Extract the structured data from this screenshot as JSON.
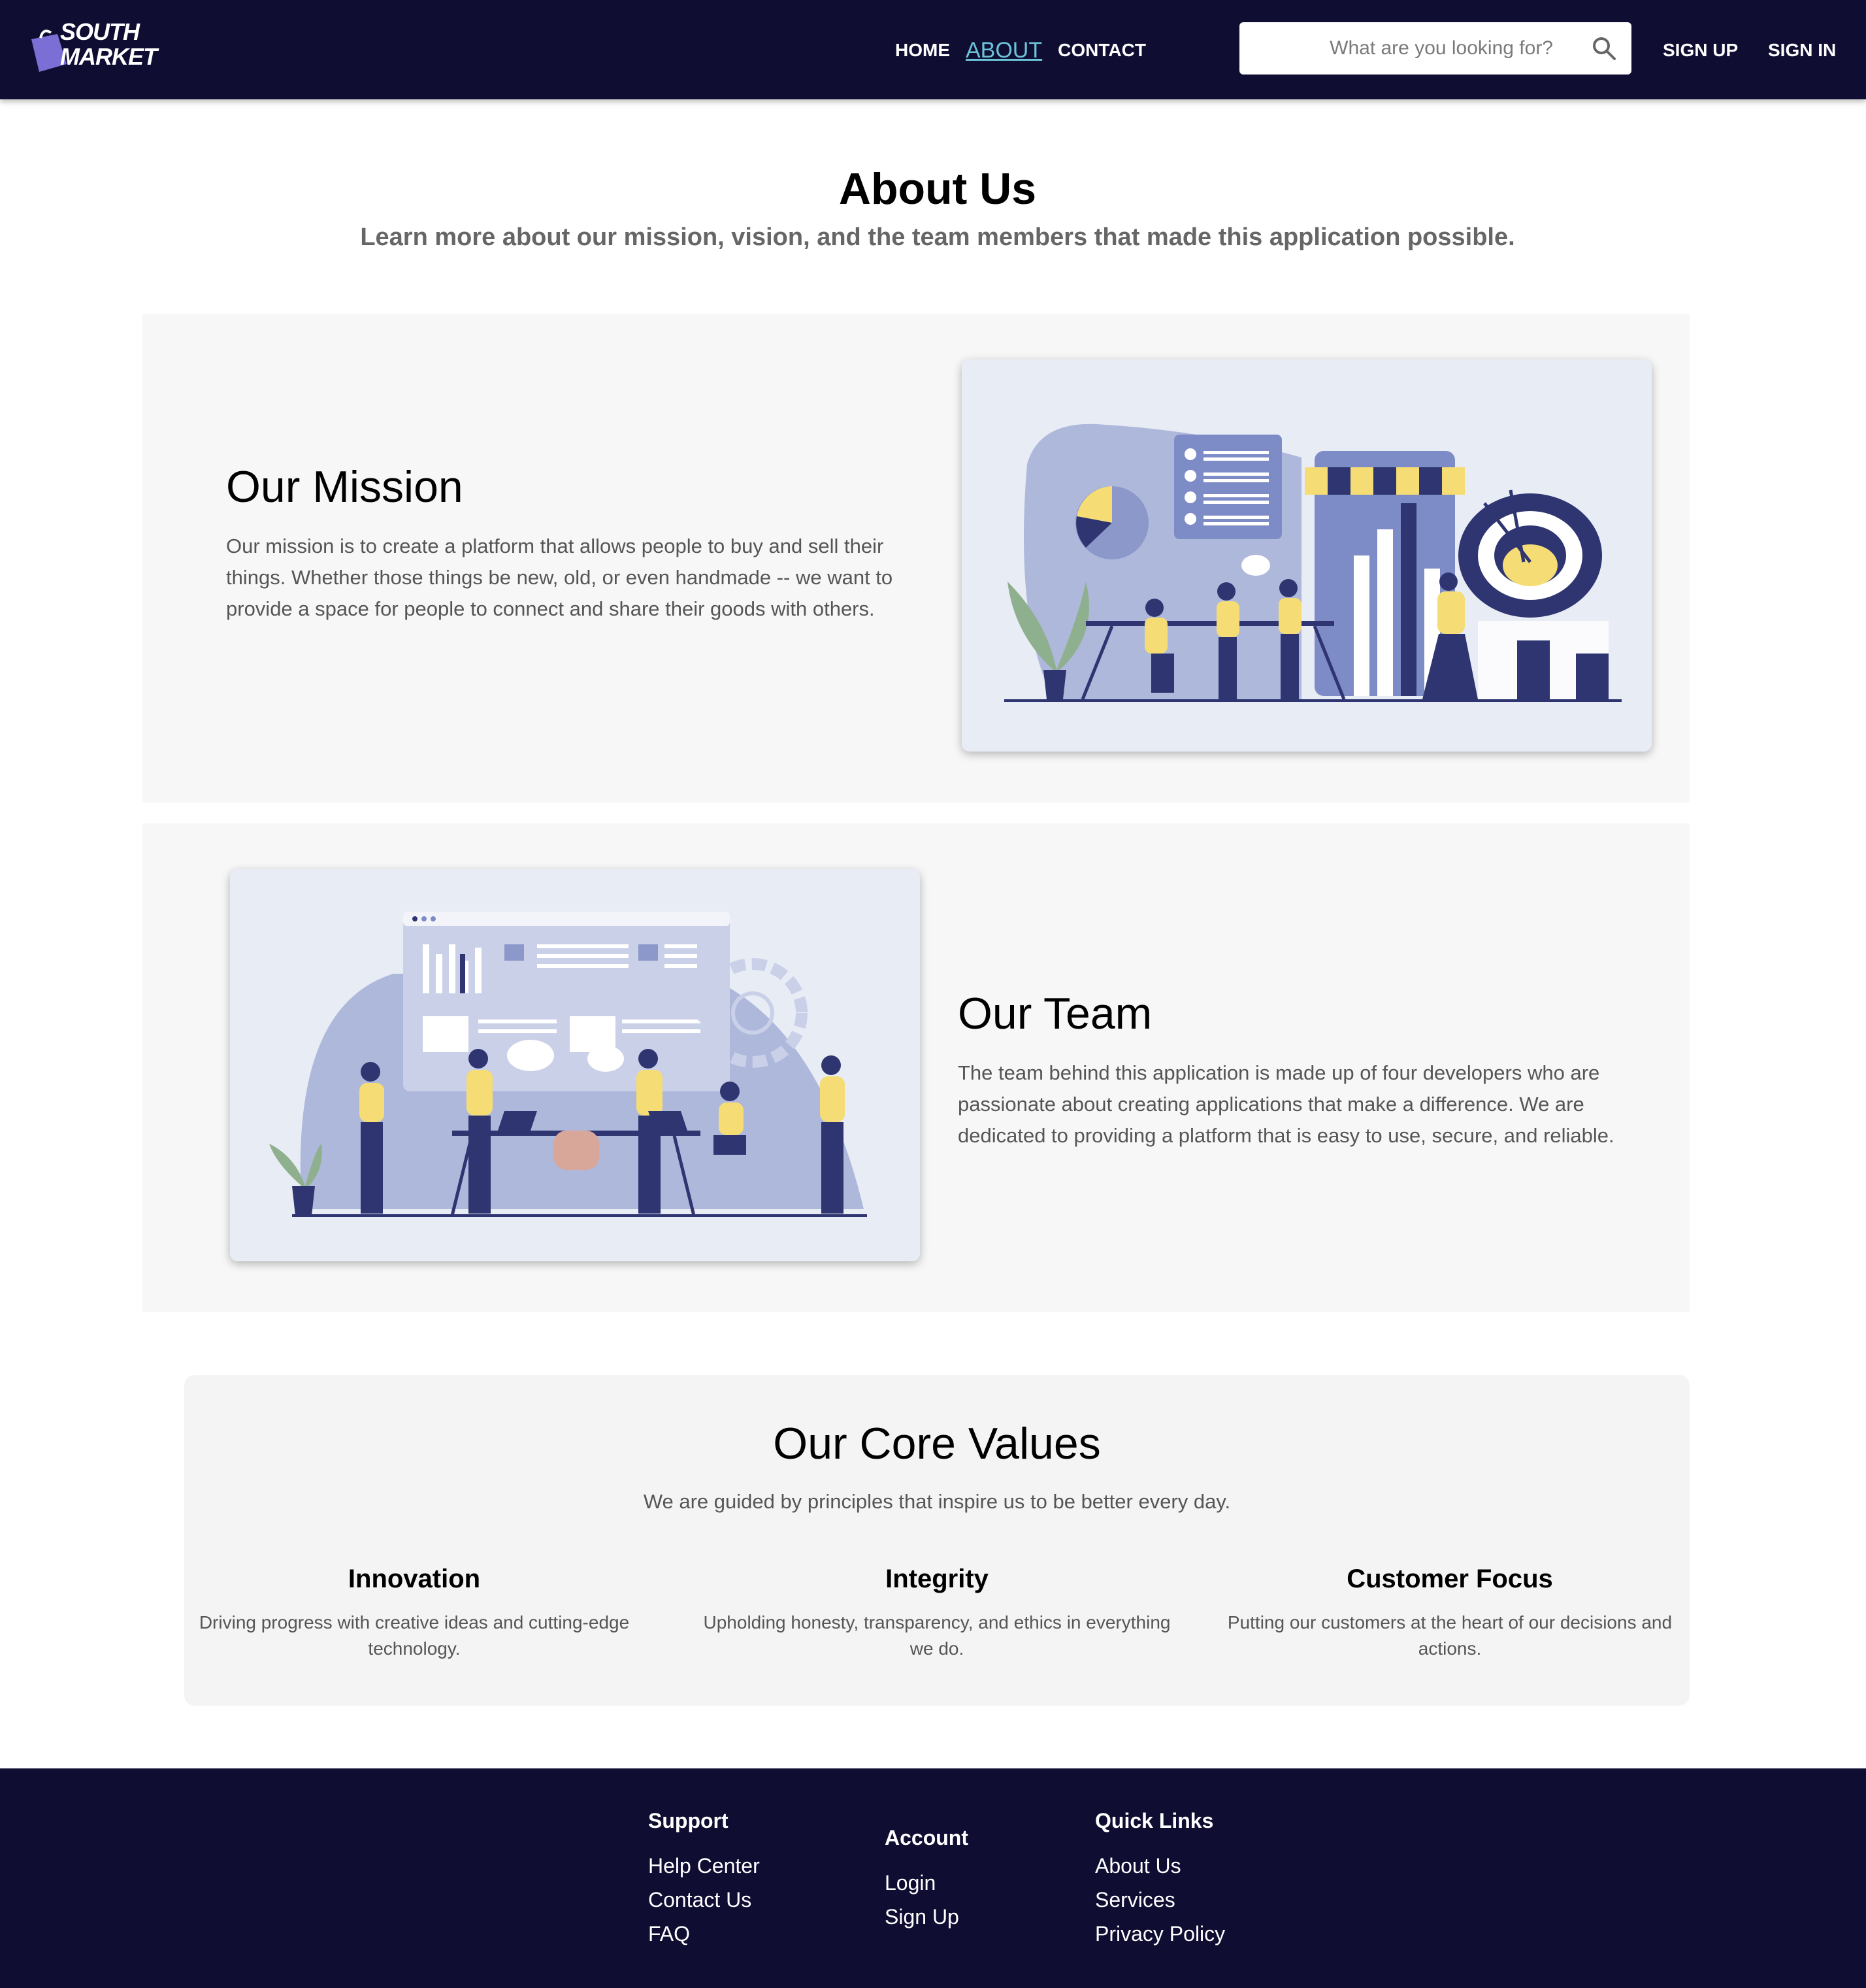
{
  "brand": {
    "logo_line1": "SOUTH",
    "logo_line2": "MARKET"
  },
  "nav": {
    "home": "HOME",
    "about": "ABOUT",
    "contact": "CONTACT"
  },
  "search": {
    "placeholder": "What are you looking for?",
    "value": ""
  },
  "auth": {
    "sign_up": "SIGN UP",
    "sign_in": "SIGN IN"
  },
  "hero": {
    "title": "About Us",
    "subtitle": "Learn more about our mission, vision, and the team members that made this application possible."
  },
  "mission": {
    "title": "Our Mission",
    "body": "Our mission is to create a platform that allows people to buy and sell their things. Whether those things be new, old, or even handmade -- we want to provide a space for people to connect and share their goods with others."
  },
  "team": {
    "title": "Our Team",
    "body": "The team behind this application is made up of four developers who are passionate about creating applications that make a difference. We are dedicated to providing a platform that is easy to use, secure, and reliable."
  },
  "core_values": {
    "title": "Our Core Values",
    "subtitle": "We are guided by principles that inspire us to be better every day.",
    "items": [
      {
        "title": "Innovation",
        "body": "Driving progress with creative ideas and cutting-edge technology."
      },
      {
        "title": "Integrity",
        "body": "Upholding honesty, transparency, and ethics in everything we do."
      },
      {
        "title": "Customer Focus",
        "body": "Putting our customers at the heart of our decisions and actions."
      }
    ]
  },
  "footer": {
    "support": {
      "title": "Support",
      "links": [
        "Help Center",
        "Contact Us",
        "FAQ"
      ]
    },
    "account": {
      "title": "Account",
      "links": [
        "Login",
        "Sign Up"
      ]
    },
    "quick_links": {
      "title": "Quick Links",
      "links": [
        "About Us",
        "Services",
        "Privacy Policy"
      ]
    }
  },
  "colors": {
    "navbar_bg": "#100d33",
    "active_link": "#6cc3d8",
    "section_bg": "#f7f7f7",
    "illustration_blue": "#6f7db8",
    "illustration_yellow": "#f5dc74"
  }
}
